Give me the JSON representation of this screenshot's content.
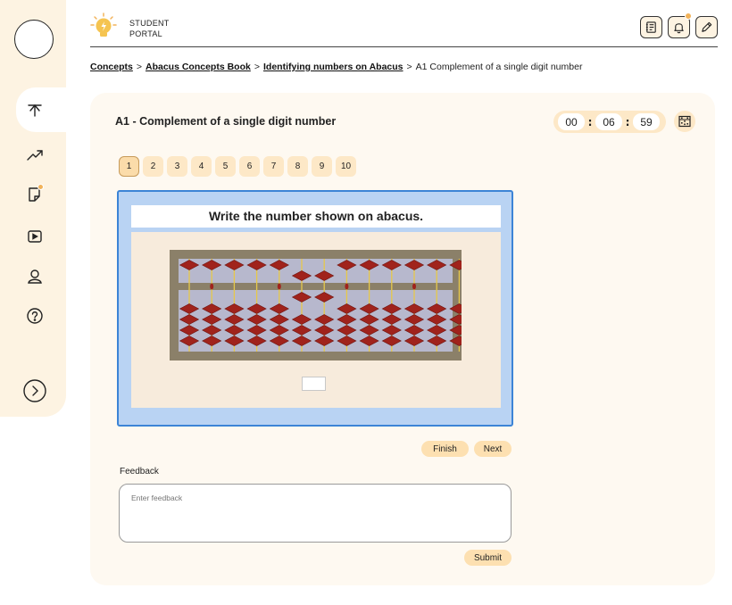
{
  "header": {
    "portal_line1": "STUDENT",
    "portal_line2": "PORTAL",
    "notification_dot_color": "#f2b35a"
  },
  "sidebar": {
    "items": [
      {
        "name": "home-icon"
      },
      {
        "name": "trending-icon"
      },
      {
        "name": "notes-icon"
      },
      {
        "name": "video-icon"
      },
      {
        "name": "profile-icon"
      },
      {
        "name": "help-icon"
      },
      {
        "name": "expand-icon"
      }
    ]
  },
  "breadcrumb": {
    "items": [
      "Concepts",
      "Abacus Concepts Book",
      "Identifying numbers on Abacus"
    ],
    "current": "A1 Complement of a single digit number",
    "separator": ">"
  },
  "exercise": {
    "title": "A1 - Complement of a single digit number",
    "timer": {
      "hours": "00",
      "minutes": "06",
      "seconds": "59"
    },
    "questions": [
      "1",
      "2",
      "3",
      "4",
      "5",
      "6",
      "7",
      "8",
      "9",
      "10"
    ],
    "active_question": "1",
    "instruction": "Write the number shown on abacus.",
    "abacus": {
      "rods": 13,
      "upper_bead_active": [
        false,
        false,
        false,
        false,
        false,
        true,
        true,
        false,
        false,
        false,
        false,
        false,
        false
      ],
      "lower_beads_active": [
        0,
        0,
        0,
        0,
        0,
        1,
        1,
        0,
        0,
        0,
        0,
        0,
        0
      ]
    },
    "answer_value": ""
  },
  "actions": {
    "finish_label": "Finish",
    "next_label": "Next",
    "submit_label": "Submit"
  },
  "feedback": {
    "label": "Feedback",
    "placeholder": "Enter feedback"
  },
  "colors": {
    "accent": "#fde0b1",
    "sidebar_bg": "#fdf3e2",
    "panel_border": "#3c84d6",
    "bead": "#a0231c"
  }
}
